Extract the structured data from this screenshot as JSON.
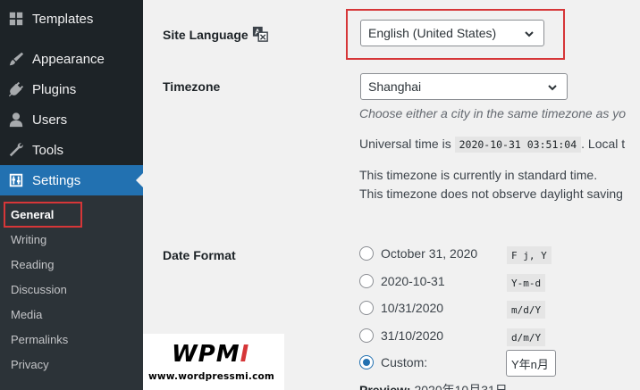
{
  "sidebar": {
    "menu": [
      {
        "label": "Templates",
        "icon": "templates-icon"
      },
      {
        "label": "Appearance",
        "icon": "brush-icon"
      },
      {
        "label": "Plugins",
        "icon": "plug-icon"
      },
      {
        "label": "Users",
        "icon": "user-icon"
      },
      {
        "label": "Tools",
        "icon": "wrench-icon"
      },
      {
        "label": "Settings",
        "icon": "settings-icon",
        "active": true
      }
    ],
    "submenu": [
      "General",
      "Writing",
      "Reading",
      "Discussion",
      "Media",
      "Permalinks",
      "Privacy"
    ],
    "current_submenu": "General"
  },
  "logo": {
    "mark_left": "WPM",
    "mark_accent": "I",
    "url": "www.wordpressmi.com"
  },
  "settings": {
    "site_language": {
      "label": "Site Language",
      "value": "English (United States)"
    },
    "timezone": {
      "label": "Timezone",
      "value": "Shanghai",
      "hint": "Choose either a city in the same timezone as yo",
      "universal_prefix": "Universal time is",
      "universal_time": "2020-10-31 03:51:04",
      "local_suffix": ". Local t",
      "standard_note": "This timezone is currently in standard time.",
      "dst_note": "This timezone does not observe daylight saving"
    },
    "date_format": {
      "label": "Date Format",
      "options": [
        {
          "label": "October 31, 2020",
          "format": "F j, Y",
          "checked": false
        },
        {
          "label": "2020-10-31",
          "format": "Y-m-d",
          "checked": false
        },
        {
          "label": "10/31/2020",
          "format": "m/d/Y",
          "checked": false
        },
        {
          "label": "31/10/2020",
          "format": "d/m/Y",
          "checked": false
        },
        {
          "label": "Custom:",
          "format": "",
          "checked": true
        }
      ],
      "custom_value": "Y年n月",
      "preview_label": "Preview:",
      "preview_value": "2020年10月31日"
    }
  },
  "colors": {
    "sidebar_bg": "#1d2327",
    "active": "#2271b1",
    "highlight": "#d63638",
    "content_bg": "#f1f1f1"
  }
}
